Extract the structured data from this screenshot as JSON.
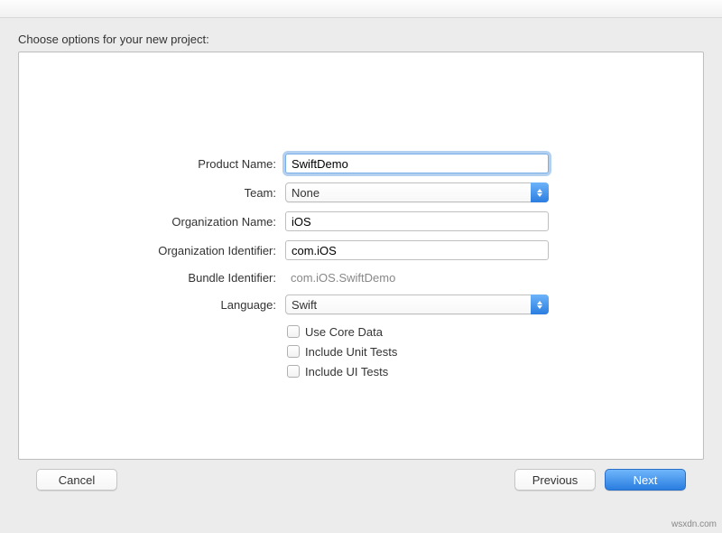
{
  "heading": "Choose options for your new project:",
  "form": {
    "product_name": {
      "label": "Product Name:",
      "value": "SwiftDemo"
    },
    "team": {
      "label": "Team:",
      "value": "None"
    },
    "org_name": {
      "label": "Organization Name:",
      "value": "iOS"
    },
    "org_id": {
      "label": "Organization Identifier:",
      "value": "com.iOS"
    },
    "bundle_id": {
      "label": "Bundle Identifier:",
      "value": "com.iOS.SwiftDemo"
    },
    "language": {
      "label": "Language:",
      "value": "Swift"
    },
    "checks": {
      "core_data": "Use Core Data",
      "unit_tests": "Include Unit Tests",
      "ui_tests": "Include UI Tests"
    }
  },
  "buttons": {
    "cancel": "Cancel",
    "previous": "Previous",
    "next": "Next"
  },
  "watermark": "wsxdn.com"
}
